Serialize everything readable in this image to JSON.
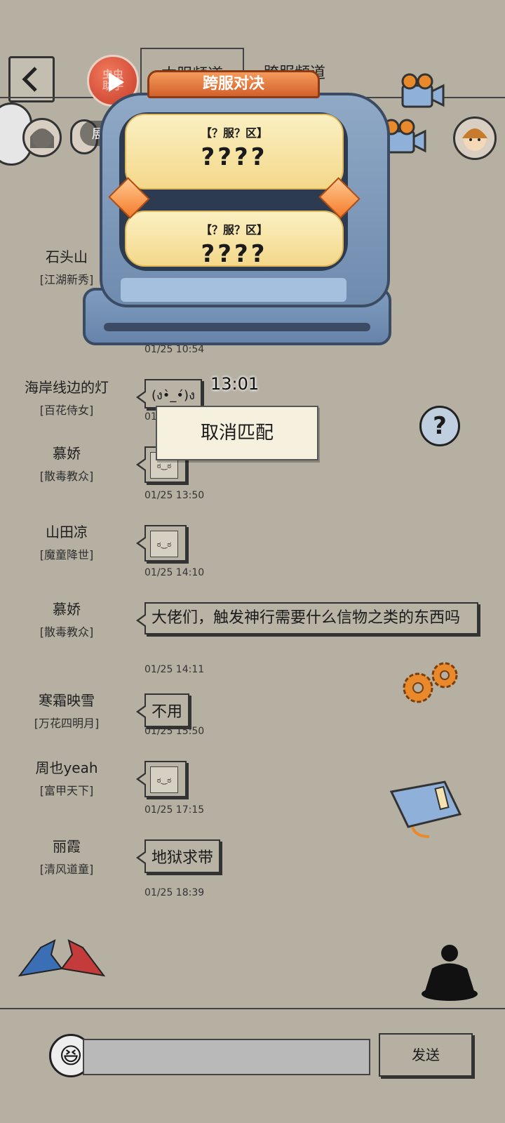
{
  "header": {
    "tab_current": "本服频道",
    "tab_cross": "跨服频道",
    "chongchong_label": "虫虫助手",
    "expand_label": "展开",
    "expand_glyph": "⤢"
  },
  "match_popup": {
    "title": "跨服对决",
    "slot1_server": "【？服？区】",
    "slot1_name": "????",
    "slot2_server": "【？服？区】",
    "slot2_name": "????",
    "timer": "13:01",
    "cancel_label": "取消匹配"
  },
  "chat": [
    {
      "name": "石头山",
      "title": "[江湖新秀]",
      "time": "01/25 10:54"
    },
    {
      "name": "海岸线边的灯",
      "title": "[百花侍女]",
      "text": "(ง•̀_•́)ง",
      "time": "01/25"
    },
    {
      "name": "慕娇",
      "title": "[散毒教众]",
      "sticker": "ಠ‿ಠ",
      "time": "01/25 13:50"
    },
    {
      "name": "山田凉",
      "title": "[魔童降世]",
      "sticker": "ಠ‿ಠ",
      "time": "01/25 14:10"
    },
    {
      "name": "慕娇",
      "title": "[散毒教众]",
      "text": "大佬们，触发神行需要什么信物之类的东西吗",
      "time": "01/25 14:11"
    },
    {
      "name": "寒霜映雪",
      "title": "[万花四明月]",
      "text": "不用",
      "time": "01/25 15:50"
    },
    {
      "name": "周也yeah",
      "title": "[富甲天下]",
      "sticker": "ಠ‿ಠ",
      "time": "01/25 17:15"
    },
    {
      "name": "丽霞",
      "title": "[清风道童]",
      "text": "地狱求带",
      "time": "01/25 18:39"
    }
  ],
  "help_label": "?",
  "composer": {
    "emoji": "😆",
    "placeholder": "",
    "send_label": "发送"
  }
}
